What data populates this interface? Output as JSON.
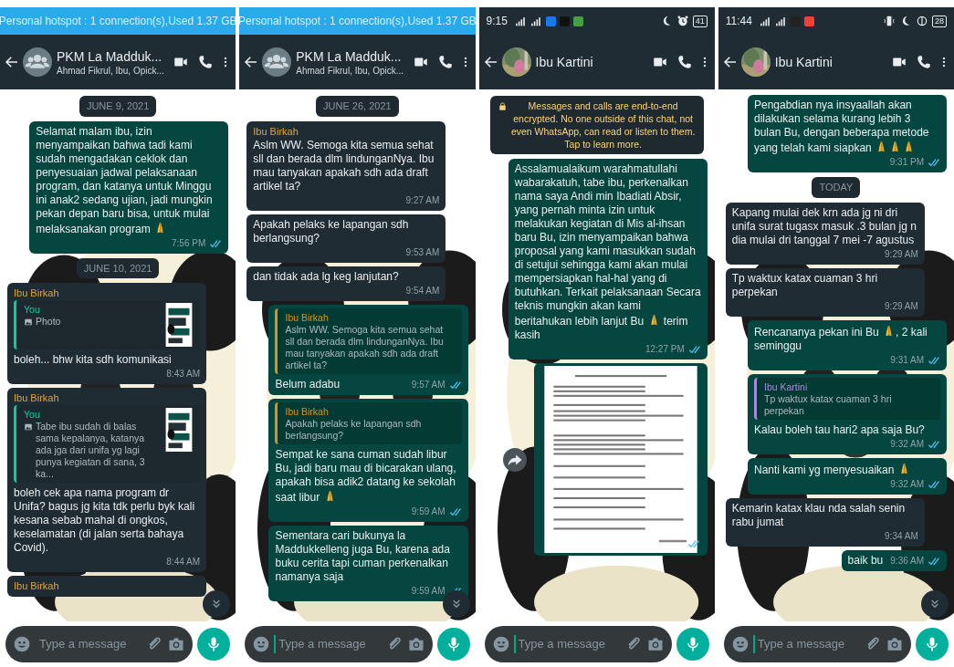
{
  "panels": [
    {
      "status": {
        "kind": "hotspot",
        "text": "Personal hotspot : 1 connection(s),Used  1.37 GB"
      },
      "header": {
        "title": "PKM La Madduk...",
        "subtitle": "Ahmad Fikrul, Ibu, Opick...",
        "group": true
      },
      "messages": [
        {
          "kind": "date",
          "text": "JUNE 9, 2021"
        },
        {
          "kind": "out",
          "parts": [
            {
              "kind": "text",
              "text": "Selamat malam ibu, izin menyampaikan bahwa tadi kami sudah mengadakan ceklok dan penyesuaian jadwal pelaksanaan program, dan katanya untuk Minggu ini anak2 sedang ujian, jadi mungkin pekan depan baru bisa, untuk mulai melaksanakan program "
            },
            {
              "kind": "pray"
            }
          ],
          "time": "7:56 PM",
          "read": true
        },
        {
          "kind": "date",
          "text": "JUNE 10, 2021"
        },
        {
          "kind": "in",
          "sender": "Ibu Birkah",
          "quote": {
            "author": "You",
            "color": "#06cf9c",
            "photo_icon": true,
            "text": "Photo",
            "thumbnail": true
          },
          "parts": [
            {
              "kind": "text",
              "text": "boleh... bhw kita sdh komunikasi"
            }
          ],
          "time": "8:43 AM"
        },
        {
          "kind": "in",
          "sender": "Ibu Birkah",
          "quote": {
            "author": "You",
            "color": "#06cf9c",
            "photo_icon": true,
            "text": "Tabe ibu sudah di balas sama kepalanya, katanya ada jga dari unifa yg lagi punya kegiatan di sana, 3 ka...",
            "thumbnail": true
          },
          "parts": [
            {
              "kind": "text",
              "text": "boleh cek apa nama program dr Unifa? bagus jg kita tdk perlu byk kali kesana sebab mahal di ongkos, keselamatan (di jalan serta bahaya Covid)."
            }
          ],
          "time": "8:44 AM"
        },
        {
          "kind": "in",
          "sender": "Ibu Birkah"
        }
      ],
      "scroll_button": true,
      "composer": {
        "placeholder": "Type a message",
        "focused": false
      }
    },
    {
      "status": {
        "kind": "hotspot",
        "text": "Personal hotspot : 1 connection(s),Used  1.37 GB"
      },
      "header": {
        "title": "PKM La Madduk...",
        "subtitle": "Ahmad Fikrul, Ibu, Opick...",
        "group": true
      },
      "messages": [
        {
          "kind": "date",
          "text": "JUNE 26, 2021"
        },
        {
          "kind": "in",
          "sender": "Ibu Birkah",
          "parts": [
            {
              "kind": "text",
              "text": "Aslm WW. Semoga kita semua sehat sll dan berada dlm lindunganNya. Ibu mau tanyakan apakah sdh ada draft artikel ta?"
            }
          ],
          "time": "9:27 AM"
        },
        {
          "kind": "in",
          "parts": [
            {
              "kind": "text",
              "text": "Apakah pelaks ke lapangan sdh berlangsung?"
            }
          ],
          "time": "9:53 AM"
        },
        {
          "kind": "in",
          "parts": [
            {
              "kind": "text",
              "text": "dan tidak ada lg keg lanjutan?"
            }
          ],
          "time": "9:54 AM"
        },
        {
          "kind": "out",
          "quote": {
            "author": "Ibu Birkah",
            "color": "#d9911f",
            "text": "Aslm WW. Semoga kita semua sehat sll dan berada dlm lindunganNya. Ibu mau tanyakan apakah sdh ada draft artikel ta?"
          },
          "parts": [
            {
              "kind": "text",
              "text": "Belum adabu"
            }
          ],
          "time": "9:57 AM",
          "read": true
        },
        {
          "kind": "out",
          "quote": {
            "author": "Ibu Birkah",
            "color": "#d9911f",
            "text": "Apakah pelaks ke lapangan sdh berlangsung?"
          },
          "parts": [
            {
              "kind": "text",
              "text": "Sempat ke sana cuman sudah libur Bu, jadi baru mau di bicarakan ulang, apakah bisa adik2 datang ke sekolah saat libur "
            },
            {
              "kind": "pray"
            }
          ],
          "time": "9:59 AM",
          "read": true
        },
        {
          "kind": "out",
          "parts": [
            {
              "kind": "text",
              "text": "Sementara cari bukunya la Maddukkelleng juga Bu, karena ada buku cerita tapi cuman perkenalkan namanya saja"
            }
          ],
          "time": "9:59 AM",
          "read": true
        }
      ],
      "scroll_button": true,
      "composer": {
        "placeholder": "Type a message",
        "focused": true
      }
    },
    {
      "status": {
        "kind": "phone",
        "time": "9:15",
        "battery": "41",
        "left_icons": [
          {
            "kind": "signal"
          },
          {
            "kind": "signal"
          },
          {
            "kind": "app",
            "color": "#1877f2"
          },
          {
            "kind": "app",
            "color": "#111111"
          },
          {
            "kind": "app",
            "color": "#43a047"
          }
        ],
        "right_icons": [
          {
            "kind": "moon"
          },
          {
            "kind": "alarm"
          }
        ]
      },
      "header": {
        "title": "Ibu Kartini",
        "group": false
      },
      "messages": [
        {
          "kind": "notice",
          "text": "Messages and calls are end-to-end encrypted. No one outside of this chat, not even WhatsApp, can read or listen to them. Tap to learn more."
        },
        {
          "kind": "out",
          "parts": [
            {
              "kind": "text",
              "text": "Assalamualaikum warahmatullahi wabarakatuh, tabe ibu, perkenalkan nama saya Andi min Ibadiati Absir, yang pernah minta izin untuk melakukan kegiatan di Mis al-ihsan baru Bu, izin menyampaikan bahwa proposal yang kami masukkan sudah di setujui sehingga kami akan mulai mempersiapkan hal-hal yang di butuhkan. Terkait pelaksanaan Secara teknis mungkin akan kami beritahukan lebih lanjut Bu "
            },
            {
              "kind": "pray"
            },
            {
              "kind": "text",
              "text": " terim kasih"
            }
          ],
          "time": "12:27 PM",
          "read": true
        },
        {
          "kind": "document",
          "read": true,
          "forward": true
        }
      ],
      "composer": {
        "placeholder": "Type a message",
        "focused": true
      }
    },
    {
      "status": {
        "kind": "phone",
        "time": "11:44",
        "battery": "28",
        "left_icons": [
          {
            "kind": "signal"
          },
          {
            "kind": "signal"
          },
          {
            "kind": "app",
            "color": "#222222"
          },
          {
            "kind": "app",
            "color": "#ea4335"
          }
        ],
        "right_icons": [
          {
            "kind": "vibrate"
          },
          {
            "kind": "moon"
          },
          {
            "kind": "sync"
          }
        ]
      },
      "header": {
        "title": "Ibu Kartini",
        "group": false
      },
      "messages": [
        {
          "kind": "out",
          "parts": [
            {
              "kind": "text",
              "text": "Pengabdian nya insyaallah akan dilakukan selama kurang lebih 3 bulan Bu, dengan beberapa metode yang telah kami siapkan "
            },
            {
              "kind": "pray"
            },
            {
              "kind": "pray"
            },
            {
              "kind": "pray"
            }
          ],
          "time": "9:31 PM",
          "read": true
        },
        {
          "kind": "date",
          "text": "TODAY"
        },
        {
          "kind": "in",
          "parts": [
            {
              "kind": "text",
              "text": "Kapang mulai dek krn ada jg ni dri unifa surat tugasx masuk .3 bulan jg n dia mulai dri tanggal 7 mei -7 agustus"
            }
          ],
          "time": "9:29 AM"
        },
        {
          "kind": "in",
          "parts": [
            {
              "kind": "text",
              "text": "Tp waktux katax cuaman 3 hri perpekan"
            }
          ],
          "time": "9:29 AM"
        },
        {
          "kind": "out",
          "parts": [
            {
              "kind": "text",
              "text": "Rencananya pekan ini Bu "
            },
            {
              "kind": "pray"
            },
            {
              "kind": "text",
              "text": ", 2 kali seminggu"
            }
          ],
          "time": "9:31 AM",
          "read": true
        },
        {
          "kind": "out",
          "quote": {
            "author": "Ibu Kartini",
            "color": "#a78bdb",
            "text": "Tp waktux katax cuaman 3 hri perpekan"
          },
          "parts": [
            {
              "kind": "text",
              "text": "Kalau boleh tau hari2 apa saja Bu?"
            }
          ],
          "time": "9:32 AM",
          "read": true
        },
        {
          "kind": "out",
          "parts": [
            {
              "kind": "text",
              "text": "Nanti kami yg menyesuaikan "
            },
            {
              "kind": "pray"
            }
          ],
          "time": "9:32 AM",
          "read": true
        },
        {
          "kind": "in",
          "parts": [
            {
              "kind": "text",
              "text": "Kemarin katax klau nda salah senin rabu jumat"
            }
          ],
          "time": "9:34 AM"
        },
        {
          "kind": "out",
          "parts": [
            {
              "kind": "text",
              "text": "baik bu"
            }
          ],
          "time": "9:36 AM",
          "read": true
        }
      ],
      "scroll_button": true,
      "composer": {
        "placeholder": "Type a message",
        "focused": true
      }
    }
  ]
}
